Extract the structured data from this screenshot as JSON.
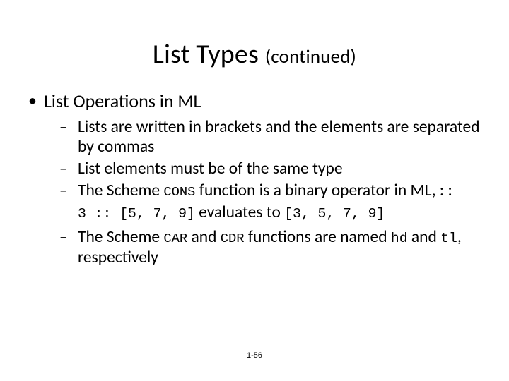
{
  "title": {
    "main": "List Types ",
    "sub": "(continued)"
  },
  "bullet1": "List Operations in ML",
  "sub1": "Lists are written in brackets and the elements are separated by commas",
  "sub2": "List elements must be of the same type",
  "sub3_a": "The Scheme ",
  "sub3_cons": "CONS",
  "sub3_b": " function is a binary operator in ML, ",
  "sub3_op": ": :",
  "example_lhs": "3 :: [5, 7, 9]",
  "example_mid": " evaluates to ",
  "example_rhs": "[3, 5, 7, 9]",
  "sub4_a": "The Scheme ",
  "sub4_car": "CAR",
  "sub4_b": " and ",
  "sub4_cdr": "CDR",
  "sub4_c": " functions are named ",
  "sub4_hd": "hd",
  "sub4_d": " and ",
  "sub4_tl": "tl",
  "sub4_e": ", respectively",
  "footer": "1-56"
}
